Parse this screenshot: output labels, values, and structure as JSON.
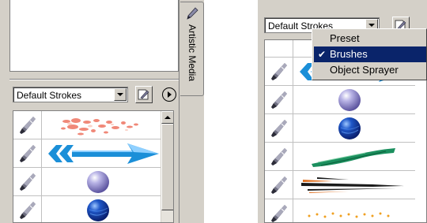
{
  "left_docker": {
    "tab_label": "Artistic Media",
    "tab_icon": "artistic-media-icon",
    "stroke_dropdown": {
      "value": "Default Strokes"
    },
    "save_icon": "save-stroke-icon",
    "flyout_icon": "flyout-arrow-icon",
    "strokes": [
      {
        "preview": "pink-splatter-stroke"
      },
      {
        "preview": "blue-arrow-stroke"
      },
      {
        "preview": "purple-sphere-stroke"
      },
      {
        "preview": "blue-ball-stroke"
      }
    ]
  },
  "right_docker": {
    "stroke_dropdown": {
      "value": "Default Strokes"
    },
    "strokes": [
      {
        "preview": "blue-arrow-stroke"
      },
      {
        "preview": "purple-sphere-stroke"
      },
      {
        "preview": "blue-ball-stroke"
      },
      {
        "preview": "green-brush-stroke"
      },
      {
        "preview": "black-orange-speed-stroke"
      },
      {
        "preview": "orange-dots-stroke"
      }
    ]
  },
  "context_menu": {
    "items": [
      {
        "label": "Preset",
        "checked": false,
        "selected": false
      },
      {
        "label": "Brushes",
        "checked": true,
        "selected": true
      },
      {
        "label": "Object Sprayer",
        "checked": false,
        "selected": false
      }
    ],
    "check_glyph": "✔"
  },
  "colors": {
    "panel": "#d4d0c8",
    "highlight": "#0a246a",
    "arrow_blue": "#1b8fd8"
  }
}
